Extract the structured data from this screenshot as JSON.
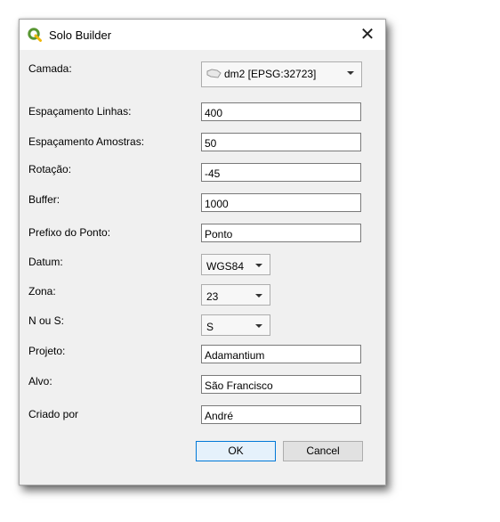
{
  "window": {
    "title": "Solo Builder",
    "close_glyph": "✕",
    "app_icon": "qgis-logo-icon"
  },
  "form": {
    "camada": {
      "label": "Camada:",
      "value": "dm2 [EPSG:32723]",
      "icon": "polygon-layer-icon"
    },
    "espacamento_linhas": {
      "label": "Espaçamento Linhas:",
      "value": "400"
    },
    "espacamento_amostras": {
      "label": "Espaçamento Amostras:",
      "value": "50"
    },
    "rotacao": {
      "label": "Rotação:",
      "value": "-45"
    },
    "buffer": {
      "label": "Buffer:",
      "value": "1000"
    },
    "prefixo": {
      "label": "Prefixo do Ponto:",
      "value": "Ponto"
    },
    "datum": {
      "label": "Datum:",
      "value": "WGS84"
    },
    "zona": {
      "label": "Zona:",
      "value": "23"
    },
    "n_ou_s": {
      "label": "N ou S:",
      "value": "S"
    },
    "projeto": {
      "label": "Projeto:",
      "value": "Adamantium"
    },
    "alvo": {
      "label": "Alvo:",
      "value": "São Francisco"
    },
    "criado_por": {
      "label": "Criado por",
      "value": "André"
    }
  },
  "buttons": {
    "ok": "OK",
    "cancel": "Cancel"
  },
  "colors": {
    "dialog_bg": "#f0f0f0",
    "ok_border": "#0078d7",
    "qgis_green": "#589632",
    "qgis_yellow": "#ee7913"
  }
}
